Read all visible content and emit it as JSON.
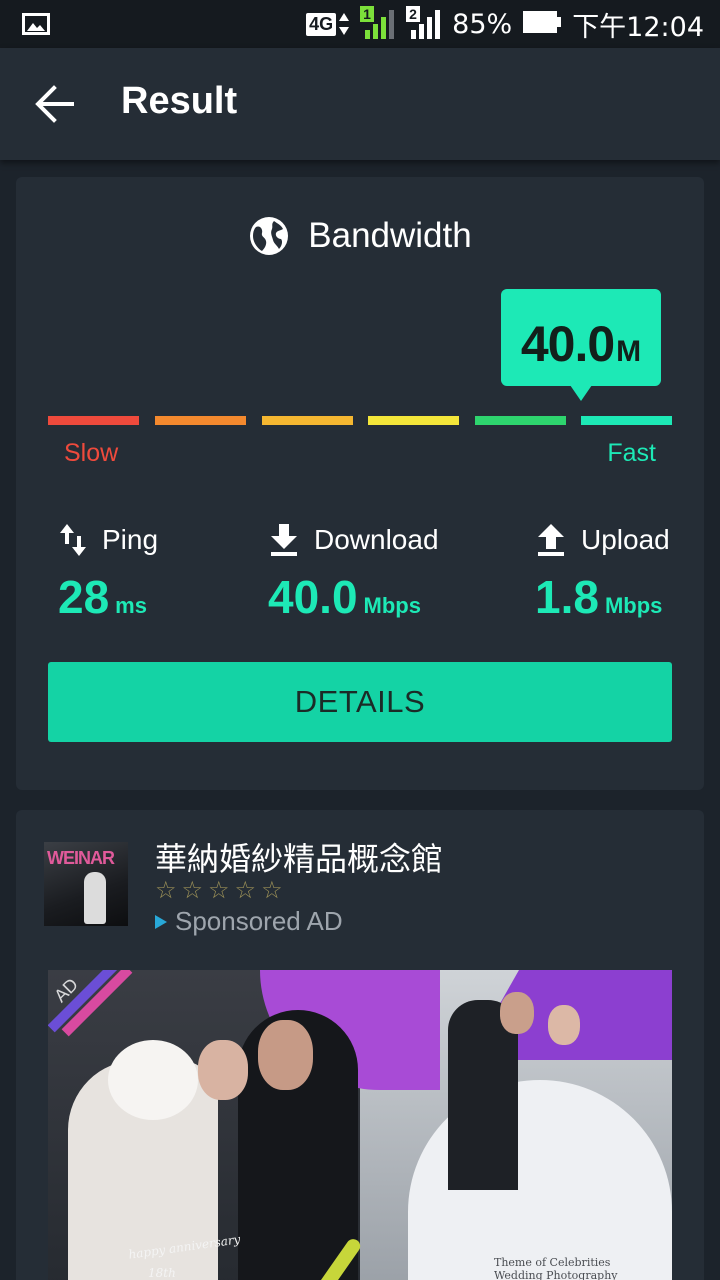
{
  "status_bar": {
    "network": "4G",
    "sim1": "1",
    "sim2": "2",
    "battery": "85%",
    "time": "下午12:04",
    "icons": [
      "gallery-icon",
      "network-4g-icon",
      "signal-sim1-icon",
      "signal-sim2-icon",
      "battery-icon"
    ]
  },
  "appbar": {
    "title": "Result",
    "back_icon": "arrow-back-icon"
  },
  "result": {
    "heading": "Bandwidth",
    "heading_icon": "globe-icon",
    "speed_value": "40.0",
    "speed_unit": "M",
    "scale_colors": [
      "#ef4a3c",
      "#f4892e",
      "#f5b731",
      "#f4e63a",
      "#2ed46e",
      "#1de9b6"
    ],
    "active_segment": 6,
    "slow_label": "Slow",
    "fast_label": "Fast",
    "stats": {
      "ping": {
        "label": "Ping",
        "value": "28",
        "unit": "ms",
        "icon": "swap-vertical-icon"
      },
      "download": {
        "label": "Download",
        "value": "40.0",
        "unit": "Mbps",
        "icon": "download-icon"
      },
      "upload": {
        "label": "Upload",
        "value": "1.8",
        "unit": "Mbps",
        "icon": "upload-icon"
      }
    },
    "details_label": "DETAILS"
  },
  "ad": {
    "title": "華納婚紗精品概念館",
    "stars": "☆☆☆☆☆",
    "sponsored": "Sponsored AD",
    "logo_text": "WEINAR",
    "image_corner_text": "AD",
    "caption_left": "happy anniversary",
    "caption_left2": "18th",
    "caption_right": "Theme of Celebrities\nWedding Photography"
  },
  "colors": {
    "accent": "#1de9b6",
    "button": "#14d3a5",
    "card_bg": "#252d36",
    "page_bg": "#1c232b"
  }
}
